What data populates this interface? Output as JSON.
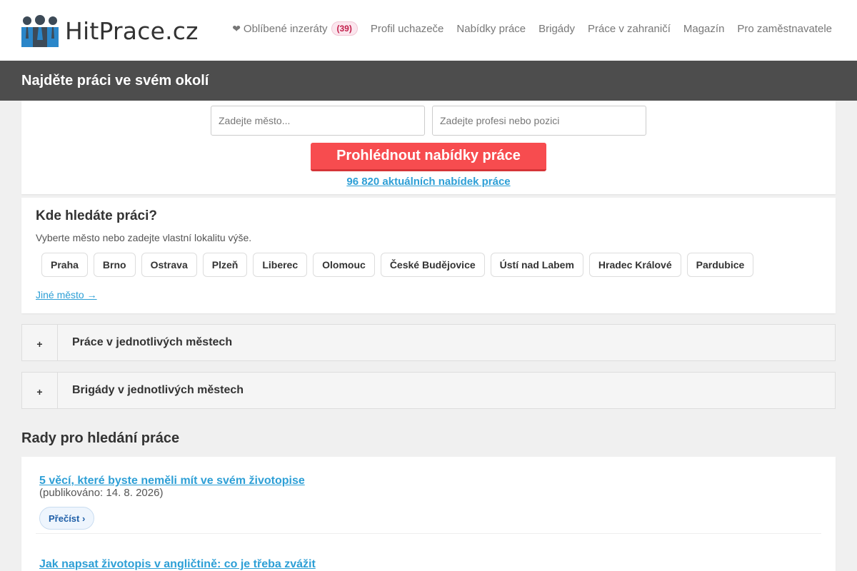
{
  "header": {
    "logo_text": "HitPrace.cz",
    "nav": {
      "favorites_label": "Oblíbené inzeráty",
      "favorites_count": "(39)",
      "items": [
        "Profil uchazeče",
        "Nabídky práce",
        "Brigády",
        "Práce v zahraničí",
        "Magazín",
        "Pro zaměstnavatele"
      ]
    }
  },
  "banner": {
    "title": "Najděte práci ve svém okolí"
  },
  "search": {
    "city_placeholder": "Zadejte město...",
    "job_placeholder": "Zadejte profesi nebo pozici",
    "button_label": "Prohlédnout nabídky práce",
    "count_link": "96 820 aktuálních nabídek práce"
  },
  "location": {
    "title": "Kde hledáte práci?",
    "subtitle": "Vyberte město nebo zadejte vlastní lokalitu výše.",
    "cities": [
      "Praha",
      "Brno",
      "Ostrava",
      "Plzeň",
      "Liberec",
      "Olomouc",
      "České Budějovice",
      "Ústí nad Labem",
      "Hradec Králové",
      "Pardubice"
    ],
    "other_link": "Jiné město →"
  },
  "accordions": [
    {
      "toggle": "+",
      "label": "Práce v jednotlivých městech"
    },
    {
      "toggle": "+",
      "label": "Brigády v jednotlivých městech"
    }
  ],
  "tips": {
    "heading": "Rady pro hledání práce",
    "items": [
      {
        "title": "5 věcí, které byste neměli mít ve svém životopise",
        "date": "(publikováno: 14. 8. 2026)",
        "read_label": "Přečíst ›"
      },
      {
        "title": "Jak napsat životopis v angličtině: co je třeba zvážit"
      }
    ]
  },
  "colors": {
    "accent_red": "#f74c4f",
    "link_blue": "#2d9fd6",
    "banner_bg": "#4d4d4d",
    "logo_blue": "#2a86c9",
    "logo_dark": "#3d4a57"
  },
  "icons": {
    "logo": "people-group-icon",
    "favorites": "heart-icon"
  }
}
